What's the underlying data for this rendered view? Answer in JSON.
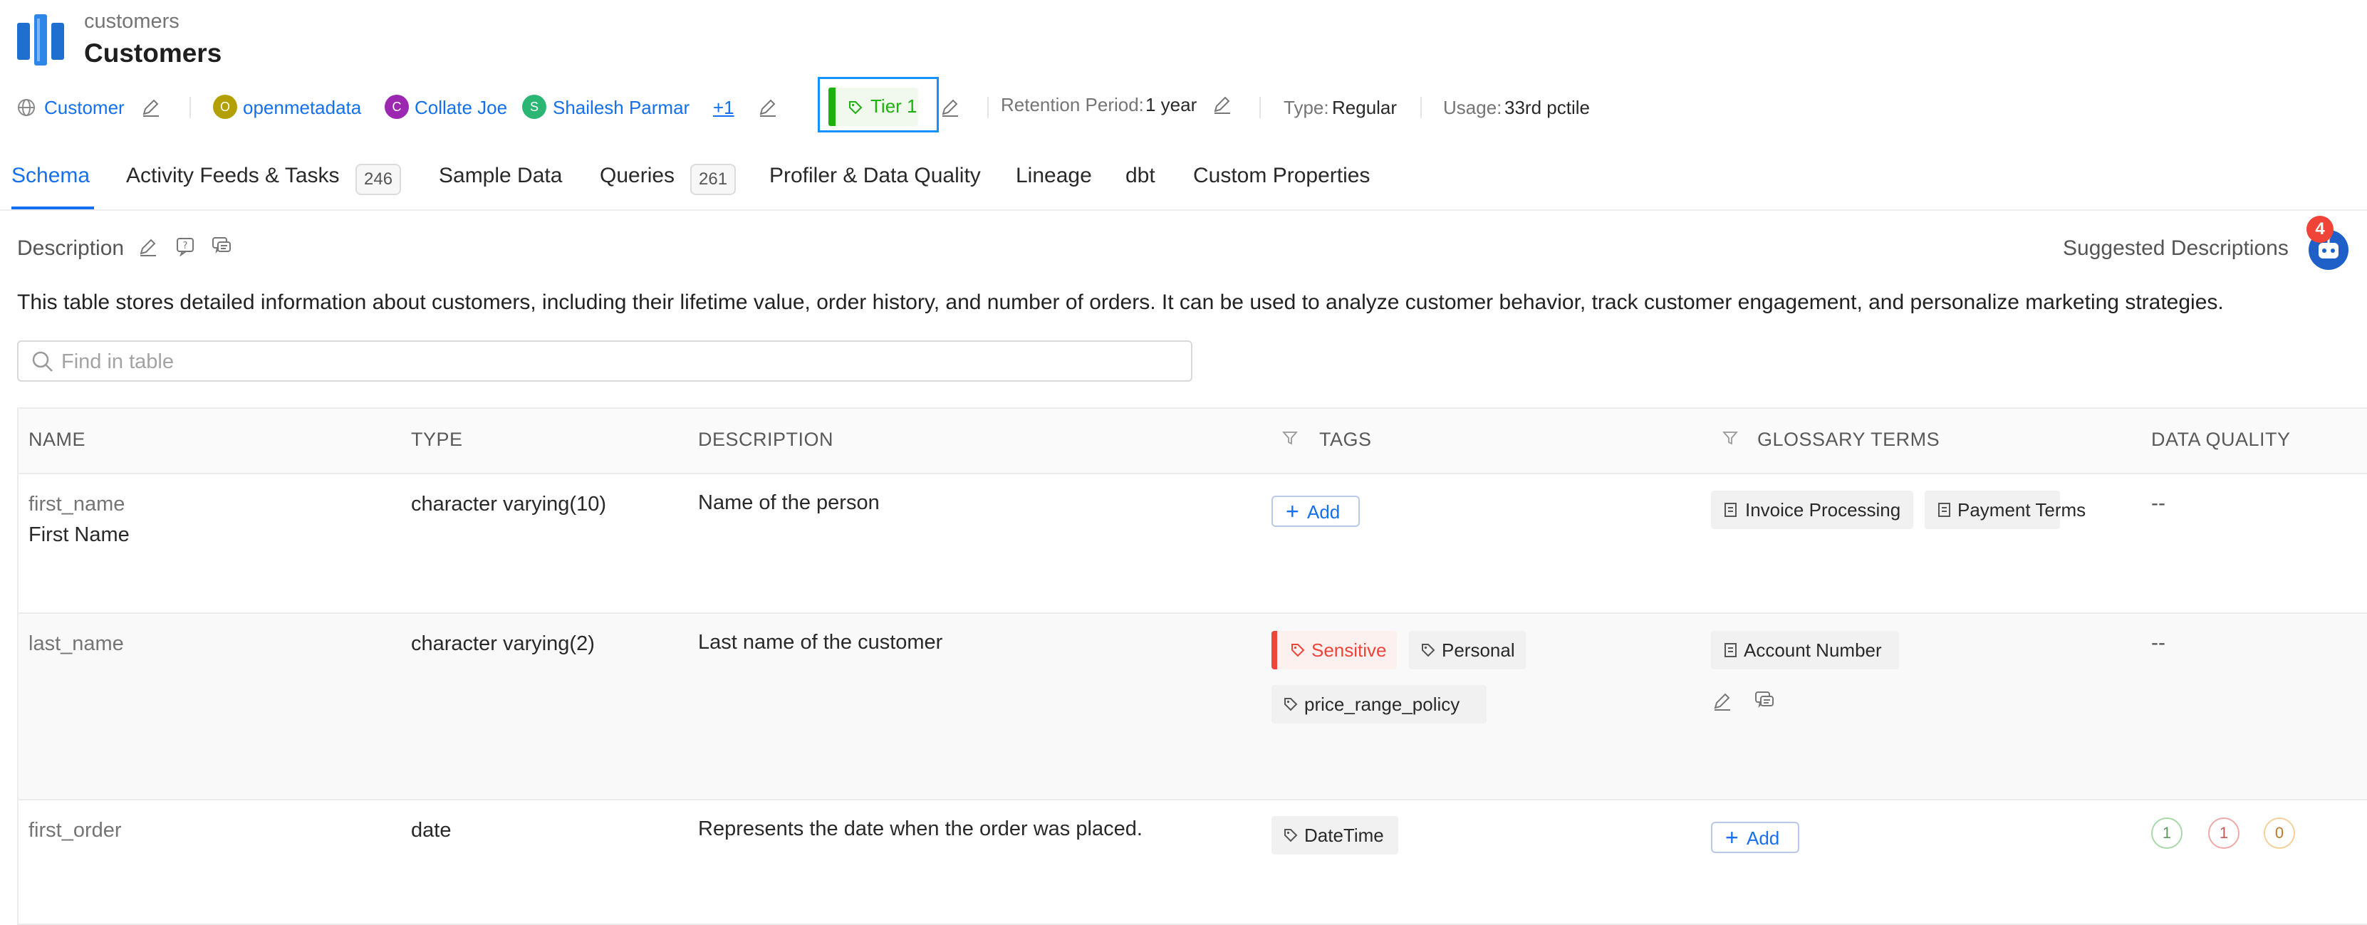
{
  "header": {
    "parent": "customers",
    "title": "Customers"
  },
  "meta": {
    "domain": "Customer",
    "owners": [
      {
        "initial": "O",
        "name": "openmetadata",
        "color": "#b3a000"
      },
      {
        "initial": "C",
        "name": "Collate Joe",
        "color": "#9c27b0"
      },
      {
        "initial": "S",
        "name": "Shailesh Parmar",
        "color": "#2bb673"
      }
    ],
    "more_owners": "+1",
    "tier": "Tier 1",
    "retention_label": "Retention Period:",
    "retention_value": "1 year",
    "type_label": "Type:",
    "type_value": "Regular",
    "usage_label": "Usage:",
    "usage_value": "33rd pctile"
  },
  "tabs": [
    {
      "label": "Schema",
      "active": true
    },
    {
      "label": "Activity Feeds & Tasks",
      "count": "246"
    },
    {
      "label": "Sample Data"
    },
    {
      "label": "Queries",
      "count": "261"
    },
    {
      "label": "Profiler & Data Quality"
    },
    {
      "label": "Lineage"
    },
    {
      "label": "dbt"
    },
    {
      "label": "Custom Properties"
    }
  ],
  "description": {
    "heading": "Description",
    "suggested": "Suggested Descriptions",
    "suggestion_count": "4",
    "text": "This table stores detailed information about customers, including their lifetime value, order history, and number of orders. It can be used to analyze customer behavior, track customer engagement, and personalize marketing strategies."
  },
  "search": {
    "placeholder": "Find in table",
    "value": ""
  },
  "table": {
    "headers": {
      "name": "NAME",
      "type": "TYPE",
      "description": "DESCRIPTION",
      "tags": "TAGS",
      "glossary": "GLOSSARY TERMS",
      "dq": "DATA QUALITY"
    },
    "add_label": "Add",
    "rows": [
      {
        "name": "first_name",
        "display_name": "First Name",
        "type": "character varying(10)",
        "description": "Name of the person",
        "glossary": [
          "Invoice Processing",
          "Payment Terms"
        ],
        "dq": "--"
      },
      {
        "name": "last_name",
        "type": "character varying(2)",
        "description": "Last name of the customer",
        "tags": [
          "Sensitive",
          "Personal",
          "price_range_policy"
        ],
        "glossary": [
          "Account Number"
        ],
        "dq": "--"
      },
      {
        "name": "first_order",
        "type": "date",
        "description": "Represents the date when the order was placed.",
        "tags": [
          "DateTime"
        ],
        "dq_counts": [
          "1",
          "1",
          "0"
        ]
      }
    ]
  },
  "colors": {
    "accent": "#1570ef",
    "tier": "#1db10e",
    "sensitive": "#f04438",
    "dq_success": "#7fc97f",
    "dq_failed": "#f0a0a0",
    "dq_aborted": "#f5c98a"
  }
}
